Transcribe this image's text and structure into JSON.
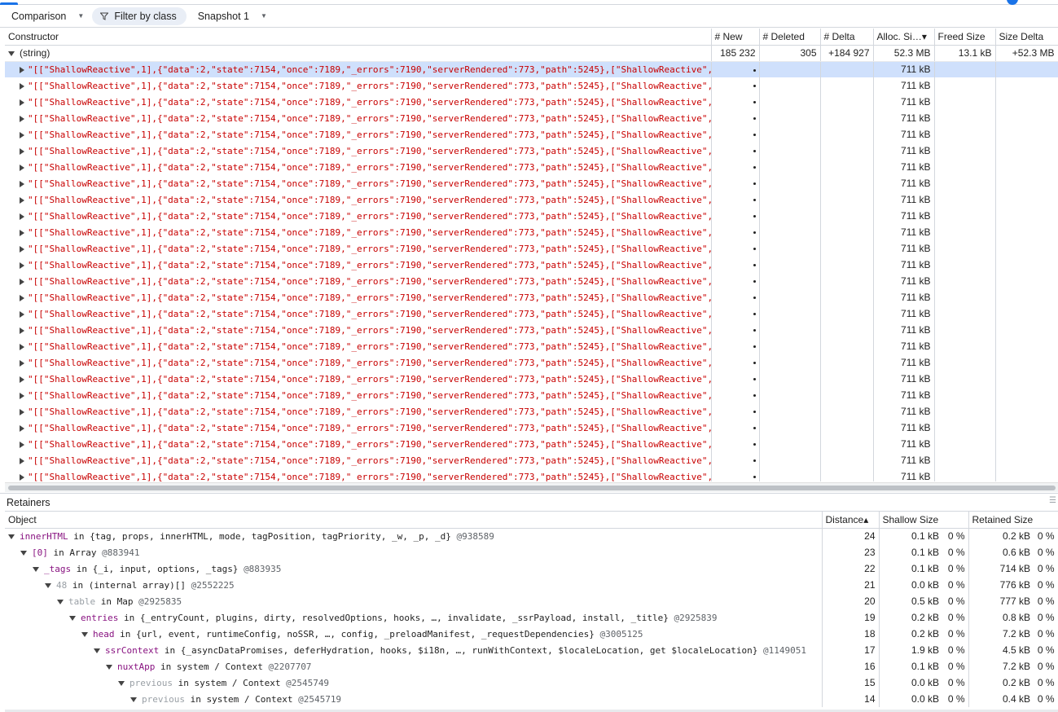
{
  "toolbar": {
    "view_mode": "Comparison",
    "filter_label": "Filter by class",
    "snapshot": "Snapshot 1"
  },
  "columns": {
    "constructor": "Constructor",
    "new": "# New",
    "deleted": "# Deleted",
    "delta": "# Delta",
    "alloc": "Alloc. Si…▾",
    "freed": "Freed Size",
    "size_delta": "Size Delta"
  },
  "summary": {
    "name": "(string)",
    "new": "185 232",
    "deleted": "305",
    "delta": "+184 927",
    "alloc": "52.3 MB",
    "freed": "13.1 kB",
    "size_delta": "+52.3 MB"
  },
  "row_string": "\"[[\"ShallowReactive\",1],{\"data\":2,\"state\":7154,\"once\":7189,\"_errors\":7190,\"serverRendered\":773,\"path\":5245},[\"ShallowReactive\",",
  "row_alloc": "711 kB",
  "row_count": 26,
  "retainers": {
    "title": "Retainers",
    "columns": {
      "object": "Object",
      "distance": "Distance▴",
      "shallow": "Shallow Size",
      "retained": "Retained Size"
    },
    "rows": [
      {
        "prop": "innerHTML",
        "dim": false,
        "in": "in",
        "desc": "{tag, props, innerHTML, mode, tagPosition, tagPriority, _w, _p, _d}",
        "id": "@938589",
        "distance": "24",
        "shallow": "0.1 kB",
        "shallow_pct": "0 %",
        "retained": "0.2 kB",
        "retained_pct": "0 %"
      },
      {
        "prop": "[0]",
        "dim": false,
        "in": "in",
        "desc": "Array",
        "id": "@883941",
        "distance": "23",
        "shallow": "0.1 kB",
        "shallow_pct": "0 %",
        "retained": "0.6 kB",
        "retained_pct": "0 %"
      },
      {
        "prop": "_tags",
        "dim": false,
        "in": "in",
        "desc": "{_i, input, options, _tags}",
        "id": "@883935",
        "distance": "22",
        "shallow": "0.1 kB",
        "shallow_pct": "0 %",
        "retained": "714 kB",
        "retained_pct": "0 %"
      },
      {
        "prop": "48",
        "dim": true,
        "in": "in",
        "desc": "(internal array)[]",
        "id": "@2552225",
        "distance": "21",
        "shallow": "0.0 kB",
        "shallow_pct": "0 %",
        "retained": "776 kB",
        "retained_pct": "0 %"
      },
      {
        "prop": "table",
        "dim": true,
        "in": "in",
        "desc": "Map",
        "id": "@2925835",
        "distance": "20",
        "shallow": "0.5 kB",
        "shallow_pct": "0 %",
        "retained": "777 kB",
        "retained_pct": "0 %"
      },
      {
        "prop": "entries",
        "dim": false,
        "in": "in",
        "desc": "{_entryCount, plugins, dirty, resolvedOptions, hooks, …, invalidate, _ssrPayload, install, _title}",
        "id": "@2925839",
        "distance": "19",
        "shallow": "0.2 kB",
        "shallow_pct": "0 %",
        "retained": "0.8 kB",
        "retained_pct": "0 %"
      },
      {
        "prop": "head",
        "dim": false,
        "in": "in",
        "desc": "{url, event, runtimeConfig, noSSR, …, config, _preloadManifest, _requestDependencies}",
        "id": "@3005125",
        "distance": "18",
        "shallow": "0.2 kB",
        "shallow_pct": "0 %",
        "retained": "7.2 kB",
        "retained_pct": "0 %"
      },
      {
        "prop": "ssrContext",
        "dim": false,
        "in": "in",
        "desc": "{_asyncDataPromises, deferHydration, hooks, $i18n, …, runWithContext, $localeLocation, get $localeLocation}",
        "id": "@1149051",
        "distance": "17",
        "shallow": "1.9 kB",
        "shallow_pct": "0 %",
        "retained": "4.5 kB",
        "retained_pct": "0 %"
      },
      {
        "prop": "nuxtApp",
        "dim": false,
        "in": "in",
        "desc": "system / Context",
        "id": "@2207707",
        "distance": "16",
        "shallow": "0.1 kB",
        "shallow_pct": "0 %",
        "retained": "7.2 kB",
        "retained_pct": "0 %"
      },
      {
        "prop": "previous",
        "dim": true,
        "in": "in",
        "desc": "system / Context",
        "id": "@2545749",
        "distance": "15",
        "shallow": "0.0 kB",
        "shallow_pct": "0 %",
        "retained": "0.2 kB",
        "retained_pct": "0 %"
      },
      {
        "prop": "previous",
        "dim": true,
        "in": "in",
        "desc": "system / Context",
        "id": "@2545719",
        "distance": "14",
        "shallow": "0.0 kB",
        "shallow_pct": "0 %",
        "retained": "0.4 kB",
        "retained_pct": "0 %"
      }
    ]
  }
}
